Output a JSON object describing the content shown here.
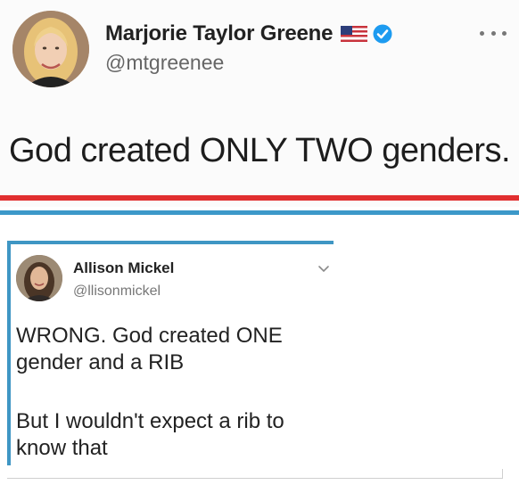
{
  "tweets": [
    {
      "author_name": "Marjorie Taylor Greene",
      "handle": "@mtgreenee",
      "text": "God created ONLY TWO genders.",
      "avatar_icon": "user-photo-blonde-woman",
      "flag_icon": "us-flag-icon",
      "badge_icon": "verified-badge-icon",
      "menu_icon": "more-options-icon"
    },
    {
      "author_name": "Allison Mickel",
      "handle": "@llisonmickel",
      "text_lines": [
        "WRONG. God created ONE",
        "gender and a RIB",
        "But I wouldn't expect a rib to",
        "know that"
      ],
      "avatar_icon": "user-photo-dark-haired-woman",
      "menu_icon": "chevron-down-icon"
    }
  ],
  "colors": {
    "divider_red": "#e12f30",
    "divider_blue": "#3c98c9",
    "verified_blue": "#1d9bf0",
    "frame_blue": "#3f96c4"
  }
}
